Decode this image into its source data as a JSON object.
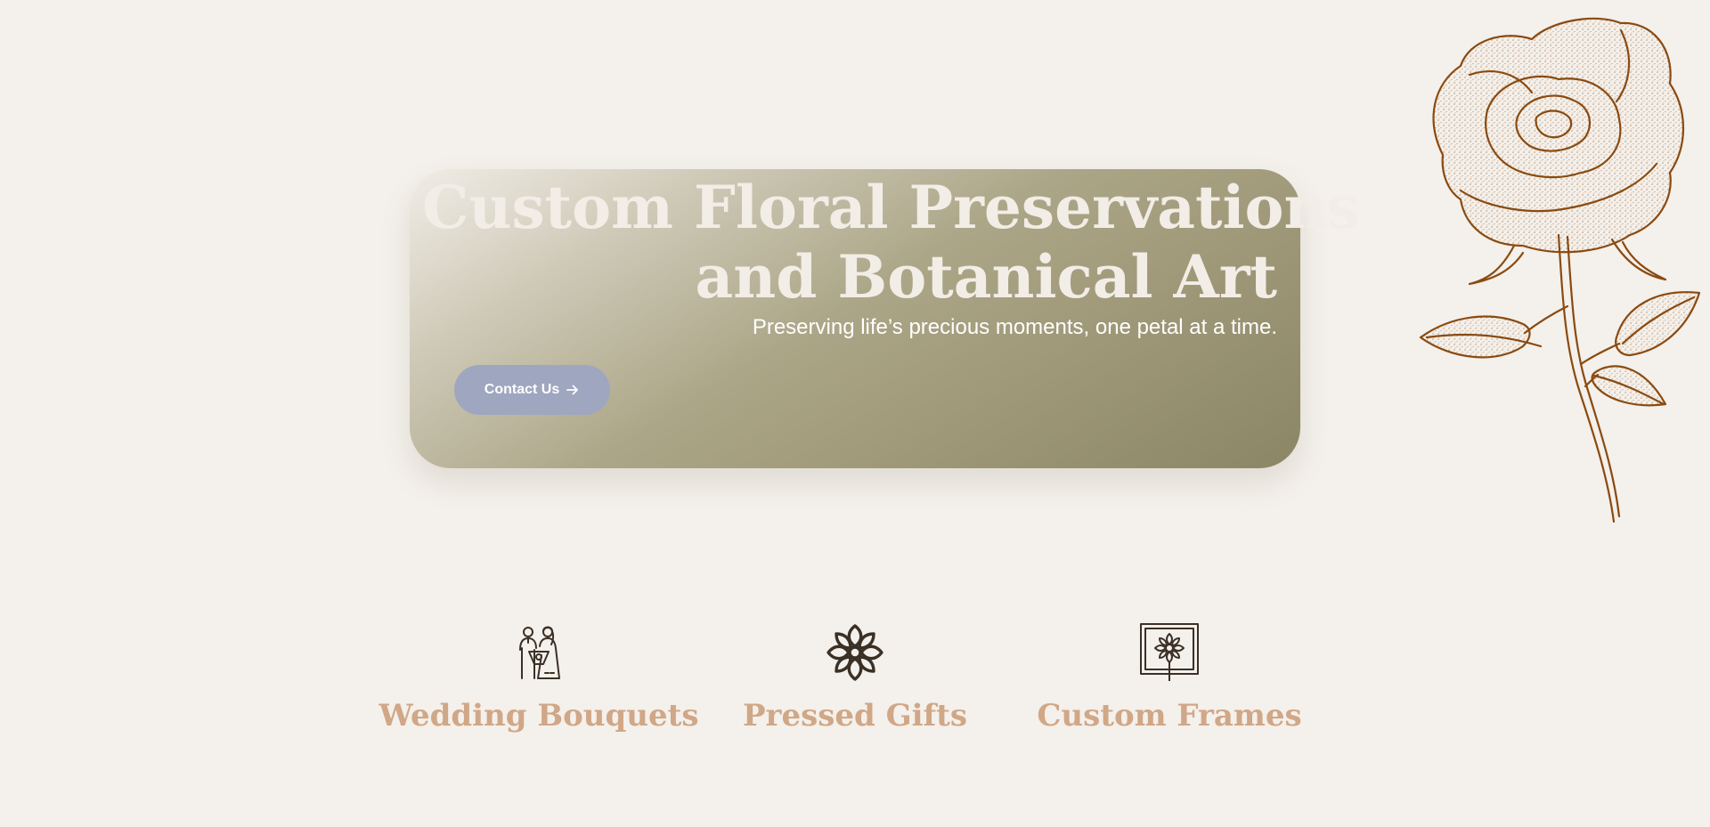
{
  "hero": {
    "title_line1": "Custom Floral Preservations",
    "title_line2": "and Botanical Art",
    "subtitle": "Preserving life’s precious moments, one petal at a time.",
    "cta_label": "Contact Us"
  },
  "services": [
    {
      "title": "Wedding Bouquets",
      "icon": "wedding-couple-icon"
    },
    {
      "title": "Pressed Gifts",
      "icon": "flower-icon"
    },
    {
      "title": "Custom Frames",
      "icon": "framed-flower-icon"
    }
  ],
  "decoration": {
    "illustration": "rose-illustration"
  },
  "colors": {
    "background": "#f4f0eb",
    "hero_gradient_start": "#f1ede7",
    "hero_gradient_end": "#8b8665",
    "hero_text": "#f2ede6",
    "button": "#9fa6bf",
    "service_title": "#d0a787",
    "rose": "#8a4a10",
    "icon": "#3a3026"
  }
}
